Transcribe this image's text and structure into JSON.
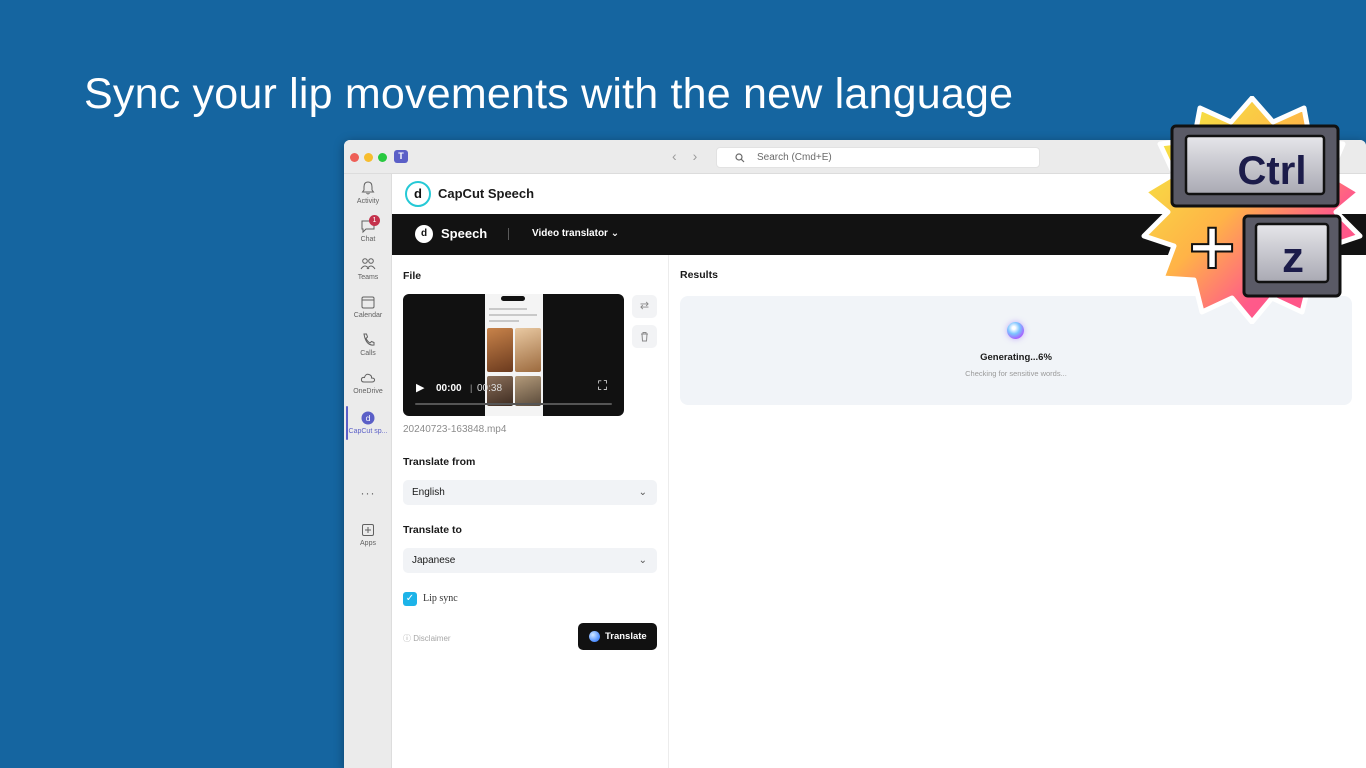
{
  "slide": {
    "title": "Sync your lip movements with the new language"
  },
  "titlebar": {
    "search_placeholder": "Search (Cmd+E)",
    "back_label": "‹",
    "forward_label": "›"
  },
  "rail": {
    "items": [
      {
        "label": "Activity",
        "icon": "bell-icon"
      },
      {
        "label": "Chat",
        "icon": "chat-icon",
        "badge": "1"
      },
      {
        "label": "Teams",
        "icon": "teams-icon"
      },
      {
        "label": "Calendar",
        "icon": "calendar-icon"
      },
      {
        "label": "Calls",
        "icon": "phone-icon"
      },
      {
        "label": "OneDrive",
        "icon": "cloud-icon"
      },
      {
        "label": "CapCut sp...",
        "icon": "capcut-icon",
        "active": true
      },
      {
        "label": "Apps",
        "icon": "plus-square-icon"
      }
    ],
    "more": "···"
  },
  "app": {
    "title": "CapCut Speech",
    "nav_speech": "Speech",
    "nav_tool": "Video translator"
  },
  "file": {
    "label": "File",
    "current_time": "00:00",
    "duration": "00:38",
    "progress": 0.0,
    "filename": "20240723-163848.mp4"
  },
  "translate_from": {
    "label": "Translate from",
    "value": "English"
  },
  "translate_to": {
    "label": "Translate to",
    "value": "Japanese"
  },
  "lip_sync": {
    "label": "Lip sync",
    "checked": true
  },
  "disclaimer": "Disclaimer",
  "translate_button": "Translate",
  "results": {
    "label": "Results",
    "status": "Generating...6%",
    "sub_status": "Checking for sensitive words..."
  },
  "sticker": {
    "key1": "Ctrl",
    "plus": "+",
    "key2": "z"
  },
  "colors": {
    "slide_bg": "#1565a0",
    "accent_checkbox": "#1db3e8",
    "teams_purple": "#5b5fc7",
    "dark_bar": "#121212"
  }
}
